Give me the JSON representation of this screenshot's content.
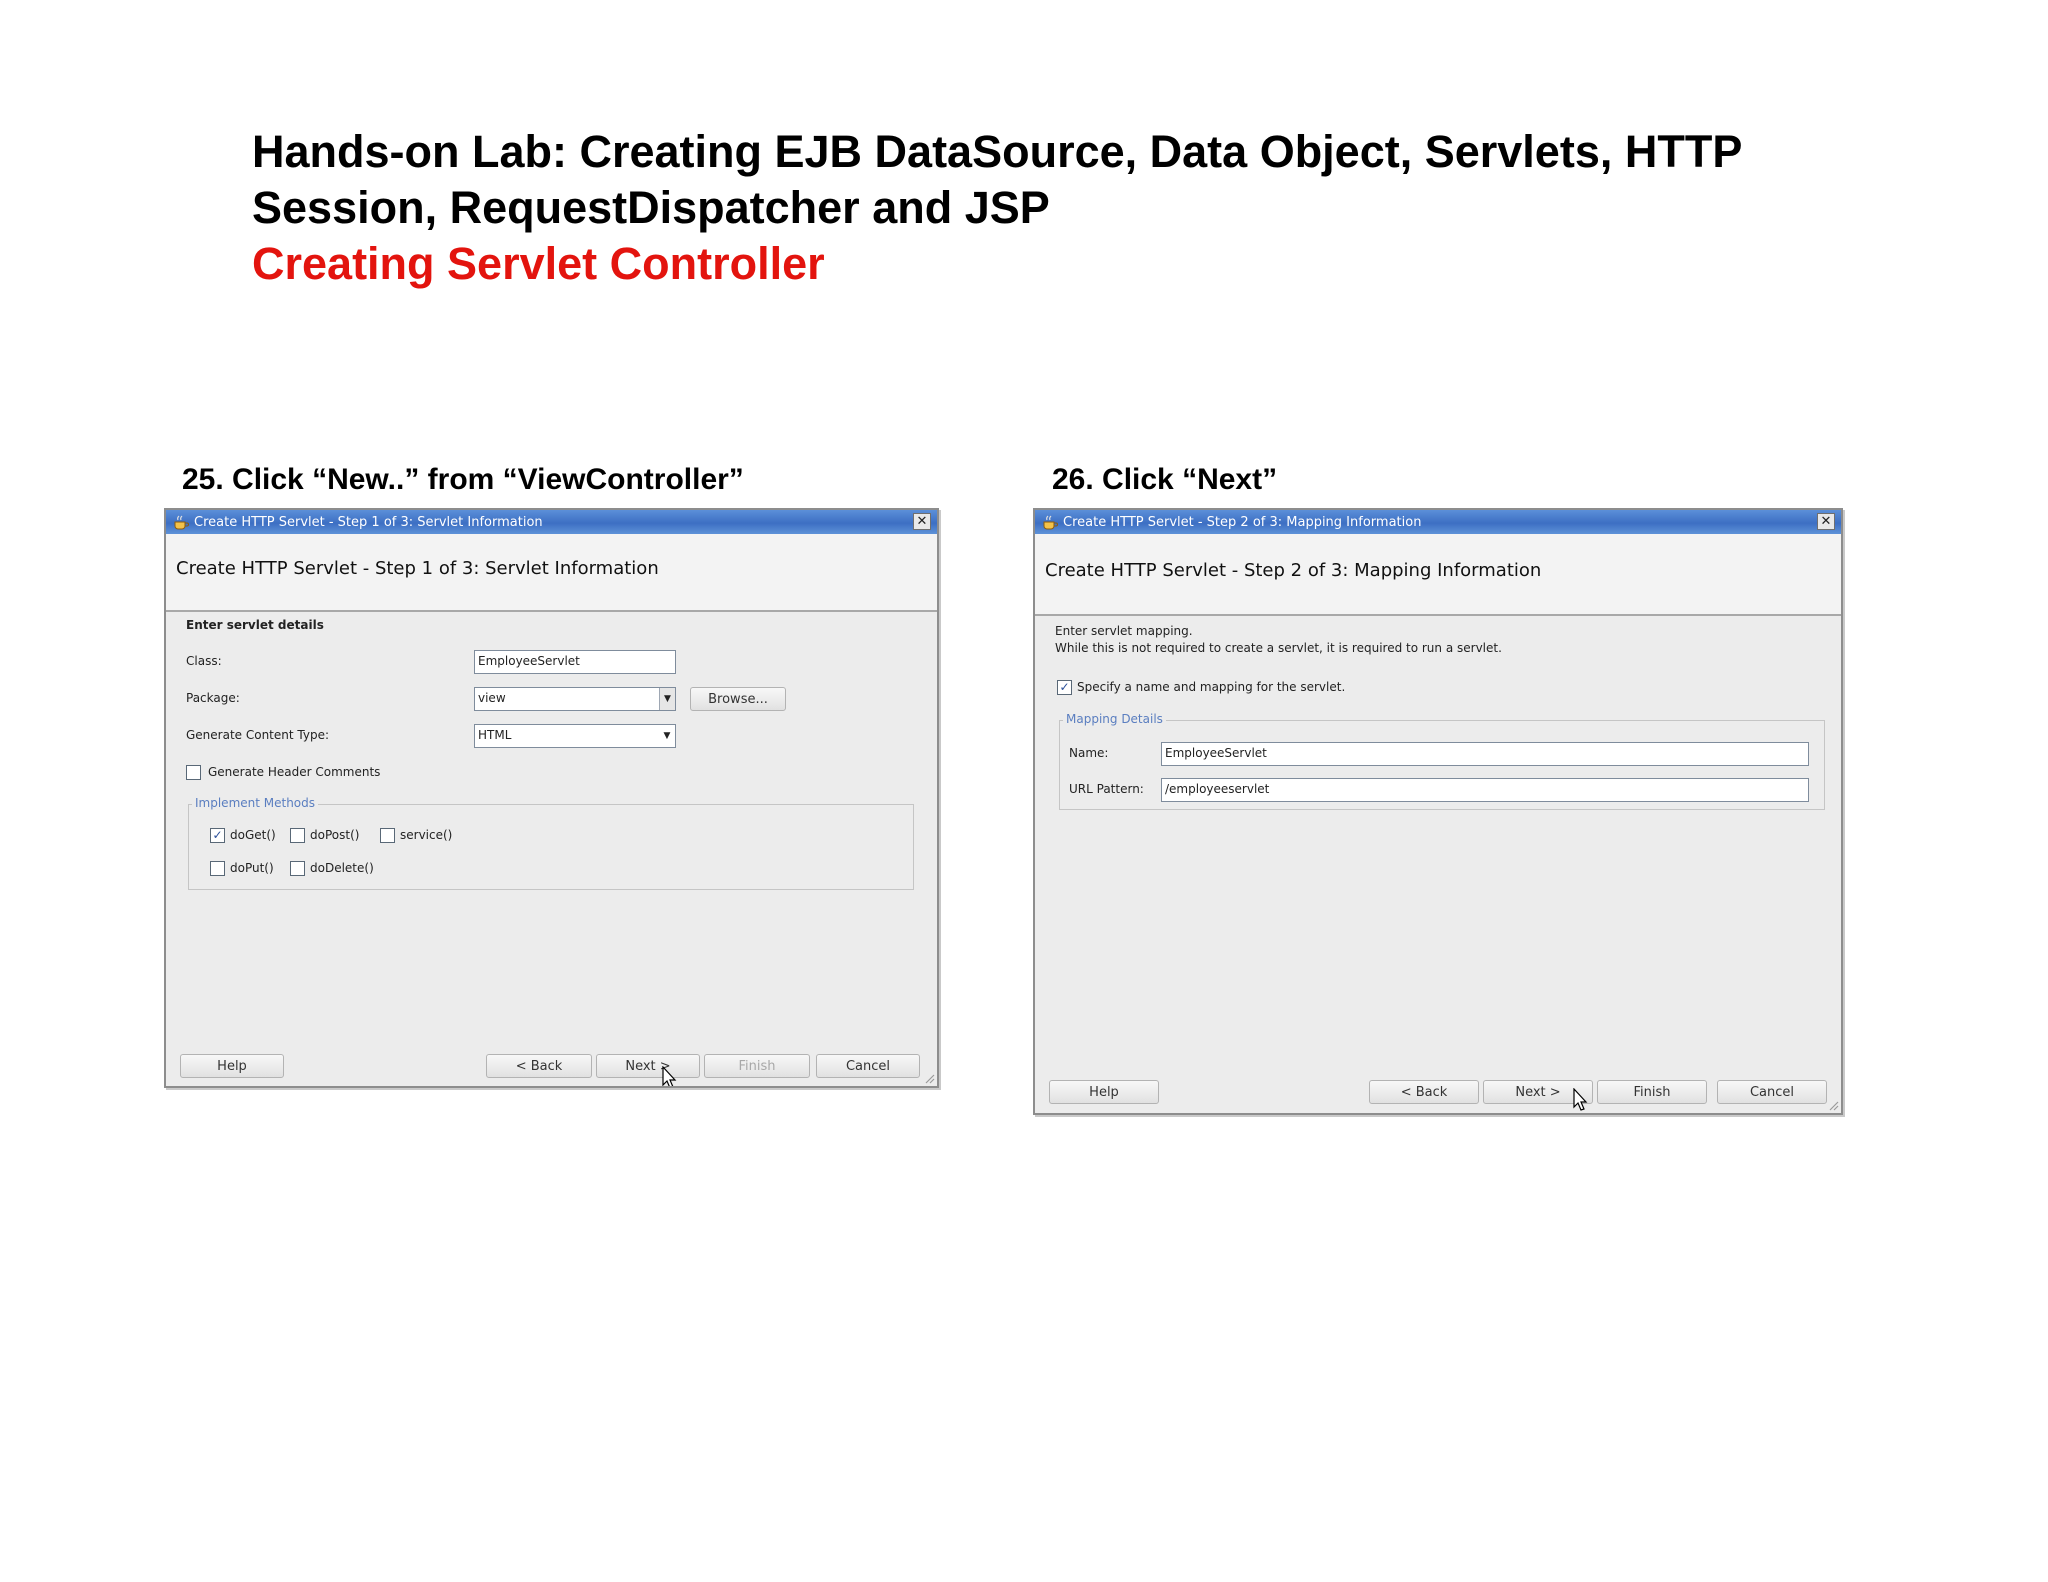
{
  "page": {
    "title_line1": "Hands-on Lab: Creating EJB DataSource, Data Object, Servlets, HTTP",
    "title_line2": "Session, RequestDispatcher and JSP",
    "subtitle": "Creating Servlet Controller"
  },
  "step25": {
    "caption": "25. Click “New..” from “ViewController”",
    "dialog": {
      "titlebar": "Create HTTP Servlet - Step 1 of 3: Servlet Information",
      "header": "Create HTTP Servlet - Step 1 of 3: Servlet Information",
      "intro": "Enter servlet details",
      "class_label": "Class:",
      "class_value": "EmployeeServlet",
      "package_label": "Package:",
      "package_value": "view",
      "browse_button": "Browse...",
      "content_type_label": "Generate Content Type:",
      "content_type_value": "HTML",
      "header_comments_label": "Generate Header Comments",
      "header_comments_checked": false,
      "methods_group": "Implement Methods",
      "methods": [
        {
          "label": "doGet()",
          "checked": true
        },
        {
          "label": "doPost()",
          "checked": false
        },
        {
          "label": "service()",
          "checked": false
        },
        {
          "label": "doPut()",
          "checked": false
        },
        {
          "label": "doDelete()",
          "checked": false
        }
      ],
      "buttons": {
        "help": "Help",
        "back": "< Back",
        "next": "Next >",
        "finish": "Finish",
        "cancel": "Cancel"
      }
    }
  },
  "step26": {
    "caption": "26. Click “Next”",
    "dialog": {
      "titlebar": "Create HTTP Servlet - Step 2 of 3: Mapping Information",
      "header": "Create HTTP Servlet - Step 2 of 3: Mapping Information",
      "intro_line1": "Enter servlet mapping.",
      "intro_line2": "While this is not required to create a servlet, it is required to run a servlet.",
      "specify_label": "Specify a name and mapping for the servlet.",
      "specify_checked": true,
      "mapping_group": "Mapping Details",
      "name_label": "Name:",
      "name_value": "EmployeeServlet",
      "url_label": "URL Pattern:",
      "url_value": "/employeeservlet",
      "buttons": {
        "help": "Help",
        "back": "< Back",
        "next": "Next >",
        "finish": "Finish",
        "cancel": "Cancel"
      }
    }
  },
  "colors": {
    "subtitle": "#e3140e",
    "titlebar": "#3d6fc3",
    "dialog_bg": "#ececec"
  }
}
